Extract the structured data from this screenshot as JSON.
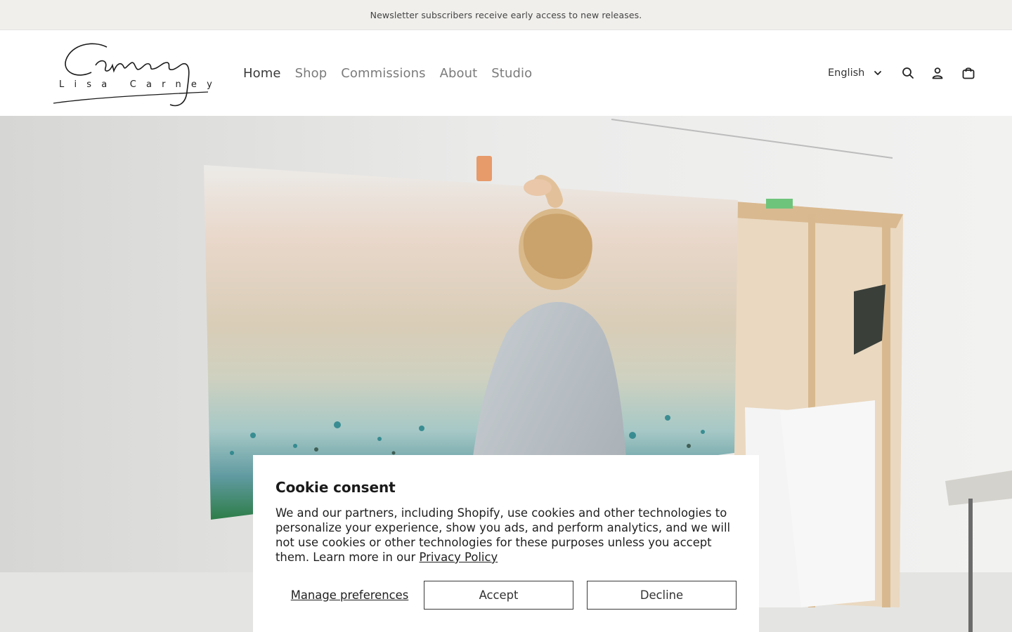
{
  "announcement": {
    "text": "Newsletter subscribers receive early access to new releases."
  },
  "header": {
    "logo_script": "Carney",
    "logo_name": "Lisa Carney",
    "nav": [
      {
        "label": "Home",
        "active": true
      },
      {
        "label": "Shop",
        "active": false
      },
      {
        "label": "Commissions",
        "active": false
      },
      {
        "label": "About",
        "active": false
      },
      {
        "label": "Studio",
        "active": false
      }
    ],
    "language": {
      "selected": "English",
      "icon": "chevron-down-icon"
    },
    "icons": [
      "search-icon",
      "account-icon",
      "cart-icon"
    ]
  },
  "hero": {
    "image": "artist painting large canvas in white studio"
  },
  "cookie": {
    "title": "Cookie consent",
    "body": "We and our partners, including Shopify, use cookies and other technologies to personalize your experience, show you ads, and perform analytics, and we will not use cookies or other technologies for these purposes unless you accept them. Learn more in our",
    "privacy_link": "Privacy Policy",
    "manage_label": "Manage preferences",
    "accept_label": "Accept",
    "decline_label": "Decline"
  }
}
